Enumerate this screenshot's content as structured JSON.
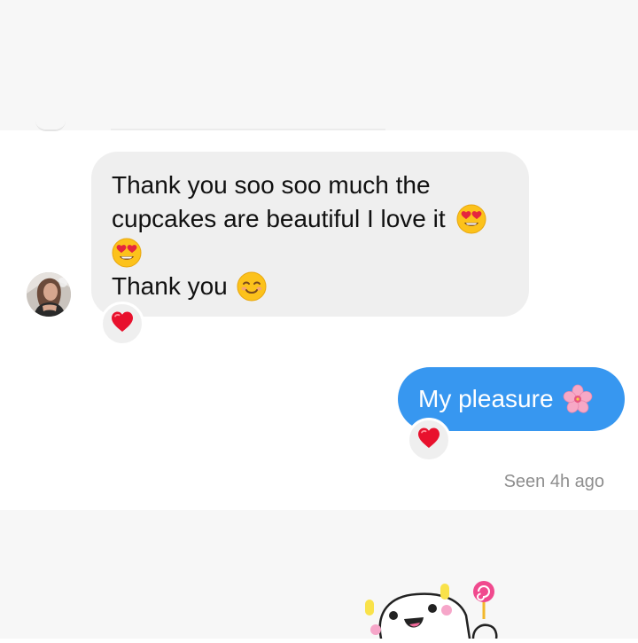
{
  "thread": {
    "incoming_message": {
      "line1": "Thank you soo soo much the",
      "line2": "cupcakes are beautiful I love it",
      "line4": "Thank you",
      "emojis": [
        "heart-eyes-emoji",
        "heart-eyes-emoji",
        "smiling-face-emoji"
      ],
      "reaction": "red-heart-emoji"
    },
    "outgoing_message": {
      "text": "My pleasure",
      "emoji": "cherry-blossom-emoji",
      "reaction": "red-heart-emoji"
    },
    "seen_status": "Seen 4h ago"
  },
  "colors": {
    "outgoing_bubble": "#3797f0",
    "incoming_bubble": "#efefef",
    "status_text": "#8e8e8e",
    "band_background": "#f7f7f7"
  }
}
